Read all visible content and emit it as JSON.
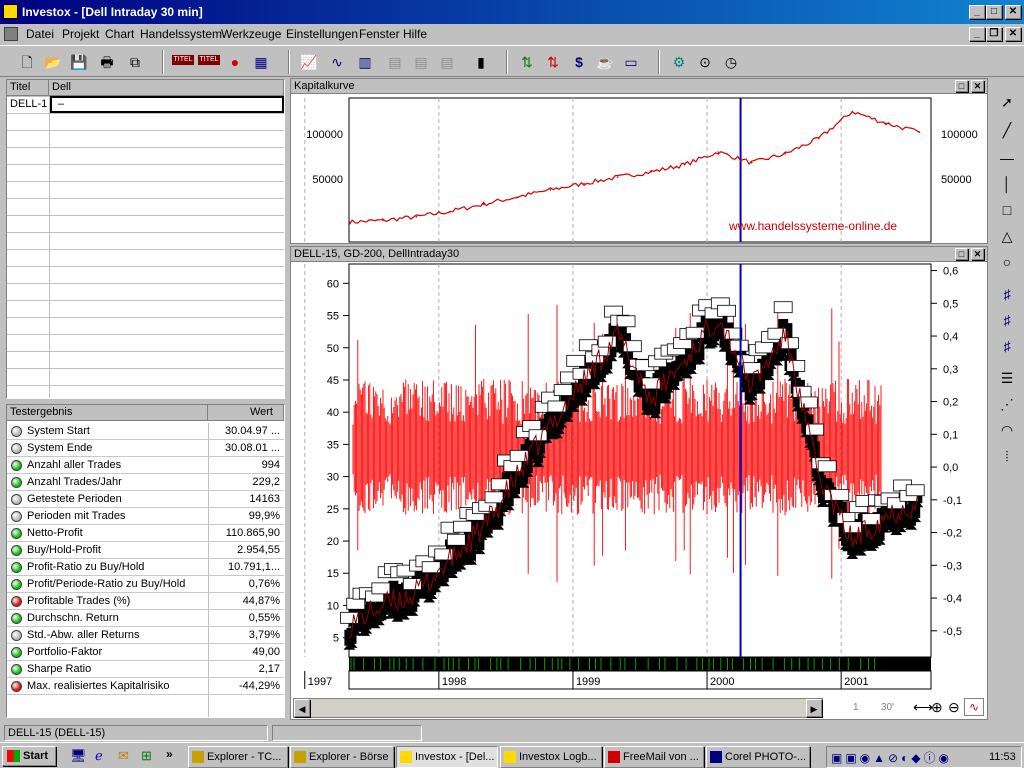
{
  "window": {
    "title": "Investox - [Dell Intraday 30 min]"
  },
  "menu": [
    "Datei",
    "Projekt",
    "Chart",
    "Handelssystem",
    "Werkzeuge",
    "Einstellungen",
    "Fenster",
    "Hilfe"
  ],
  "toolbar": {
    "titel_label": "TITEL"
  },
  "symbols_grid": {
    "col_title": "Titel",
    "col_name": "Dell",
    "rows": [
      {
        "title": "DELL-1",
        "name": "–"
      }
    ]
  },
  "results": {
    "col_name": "Testergebnis",
    "col_value": "Wert",
    "rows": [
      {
        "name": "System Start",
        "value": "30.04.97 ...",
        "status": "gray"
      },
      {
        "name": "System Ende",
        "value": "30.08.01 ...",
        "status": "gray"
      },
      {
        "name": "Anzahl aller Trades",
        "value": "994",
        "status": "green"
      },
      {
        "name": "Anzahl Trades/Jahr",
        "value": "229,2",
        "status": "green"
      },
      {
        "name": "Getestete Perioden",
        "value": "14163",
        "status": "gray"
      },
      {
        "name": "Perioden mit Trades",
        "value": "99,9%",
        "status": "gray"
      },
      {
        "name": "Netto-Profit",
        "value": "110.865,90",
        "status": "green"
      },
      {
        "name": "Buy/Hold-Profit",
        "value": "2.954,55",
        "status": "green"
      },
      {
        "name": "Profit-Ratio zu Buy/Hold",
        "value": "10.791,1...",
        "status": "green"
      },
      {
        "name": "Profit/Periode-Ratio zu Buy/Hold",
        "value": "0,76%",
        "status": "green"
      },
      {
        "name": "Profitable Trades (%)",
        "value": "44,87%",
        "status": "red"
      },
      {
        "name": "Durchschn. Return",
        "value": "0,55%",
        "status": "green"
      },
      {
        "name": "Std.-Abw. aller Returns",
        "value": "3,79%",
        "status": "gray"
      },
      {
        "name": "Portfolio-Faktor",
        "value": "49,00",
        "status": "green"
      },
      {
        "name": "Sharpe Ratio",
        "value": "2,17",
        "status": "green"
      },
      {
        "name": "Max. realisiertes Kapitalrisiko",
        "value": "-44,29%",
        "status": "red"
      }
    ]
  },
  "equity_window": {
    "title": "Kapitalkurve",
    "watermark": "www.handelssysteme-online.de"
  },
  "price_window": {
    "title": "DELL-15,  GD-200,  DellIntraday30"
  },
  "scroll_zoom": {
    "page": "1",
    "interval": "30'"
  },
  "status": {
    "left": "DELL-15 (DELL-15)"
  },
  "taskbar": {
    "start": "Start",
    "clock": "11:53",
    "tasks": [
      "Explorer - TC...",
      "Explorer - Börse",
      "Investox - [Del...",
      "Investox Logb...",
      "FreeMail von ...",
      "Corel PHOTO-..."
    ]
  },
  "colors": {
    "equity_line": "#d00000",
    "price_bar": "#ff0000",
    "trade_marker": "#000000",
    "cursor_line": "#0000c0",
    "watermark": "#d00000"
  },
  "chart_data": [
    {
      "type": "line",
      "title": "Kapitalkurve",
      "y_ticks": [
        50000,
        100000
      ],
      "x_ticks": [
        "1997",
        "1998",
        "1999",
        "2000",
        "2001"
      ],
      "series": [
        {
          "x": [
            "1997-05",
            "1997-08",
            "1997-11",
            "1998-02",
            "1998-05",
            "1998-08",
            "1998-11",
            "1999-02",
            "1999-05",
            "1999-08",
            "1999-11",
            "2000-02",
            "2000-05",
            "2000-08",
            "2000-11",
            "2001-02",
            "2001-05",
            "2001-08"
          ],
          "values": [
            2000,
            4000,
            8000,
            14000,
            22000,
            30000,
            38000,
            45000,
            52000,
            58000,
            66000,
            80000,
            68000,
            78000,
            95000,
            125000,
            112000,
            102000
          ]
        }
      ]
    },
    {
      "type": "bar",
      "title": "DELL-15,  GD-200,  DellIntraday30",
      "ylim": [
        2,
        63
      ],
      "y2lim": [
        -0.58,
        0.62
      ],
      "y_ticks": [
        5,
        10,
        15,
        20,
        25,
        30,
        35,
        40,
        45,
        50,
        55,
        60
      ],
      "y2_ticks": [
        -0.5,
        -0.4,
        -0.3,
        -0.2,
        -0.1,
        0.0,
        0.1,
        0.2,
        0.3,
        0.4,
        0.5,
        0.6
      ],
      "x_ticks": [
        "1997",
        "1998",
        "1999",
        "2000",
        "2001"
      ],
      "series": [
        {
          "x": [
            "1997-05",
            "1997-08",
            "1997-11",
            "1998-02",
            "1998-05",
            "1998-08",
            "1998-11",
            "1999-02",
            "1999-05",
            "1999-08",
            "1999-11",
            "2000-02",
            "2000-05",
            "2000-08",
            "2000-11",
            "2001-02",
            "2001-05",
            "2001-08"
          ],
          "values": [
            7,
            10,
            12,
            17,
            22,
            30,
            38,
            45,
            52,
            42,
            48,
            55,
            44,
            52,
            30,
            20,
            24,
            26
          ]
        }
      ]
    }
  ]
}
